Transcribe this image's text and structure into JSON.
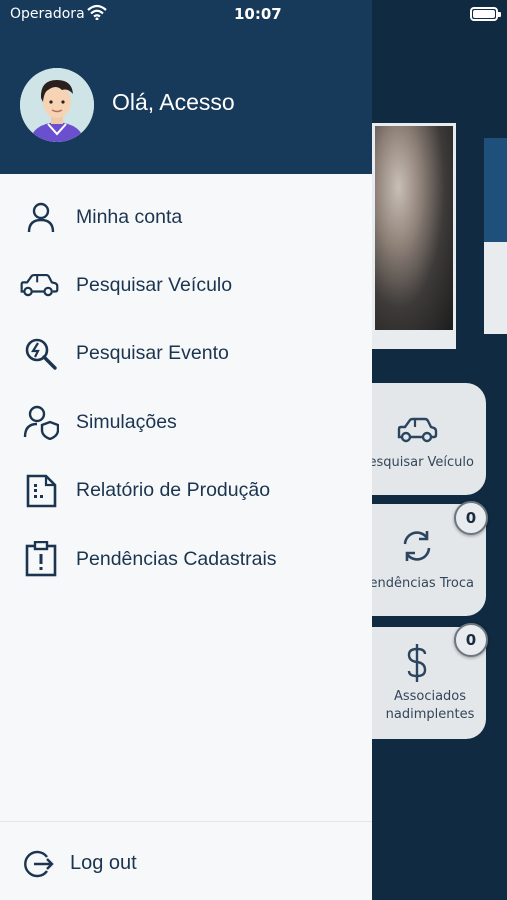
{
  "status_bar": {
    "carrier": "Operadora",
    "time": "10:07"
  },
  "drawer": {
    "greeting": "Olá, Acesso",
    "items": [
      {
        "label": "Minha conta",
        "icon": "user-icon"
      },
      {
        "label": "Pesquisar Veículo",
        "icon": "car-icon"
      },
      {
        "label": "Pesquisar Evento",
        "icon": "search-event-icon"
      },
      {
        "label": "Simulações",
        "icon": "user-shield-icon"
      },
      {
        "label": "Relatório de Produção",
        "icon": "document-icon"
      },
      {
        "label": "Pendências Cadastrais",
        "icon": "clipboard-alert-icon"
      }
    ],
    "logout_label": "Log out"
  },
  "background": {
    "tiles": [
      {
        "label": "esquisar Veículo",
        "icon": "car-icon"
      },
      {
        "label": "endências Troca",
        "icon": "refresh-icon",
        "badge": "0"
      },
      {
        "label_line1": "Associados",
        "label_line2": "nadimplentes",
        "icon": "dollar-icon",
        "badge": "0"
      }
    ]
  },
  "colors": {
    "header": "#17395a",
    "background": "#102a42",
    "text": "#1b3550",
    "drawer": "#f7f8f9"
  }
}
